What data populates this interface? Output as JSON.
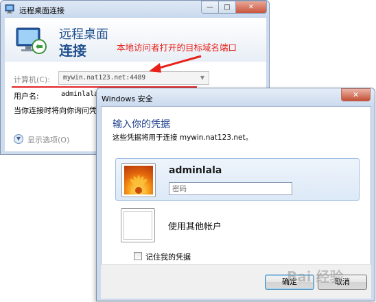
{
  "rdp_window": {
    "title": "远程桌面连接",
    "heading_line1": "远程桌面",
    "heading_line2": "连接",
    "computer_label": "计算机(C):",
    "computer_value": "mywin.nat123.net:4489",
    "username_label": "用户名:",
    "username_value": "adminlala",
    "hint_text": "当你连接时将向你询问凭",
    "show_options_label": "显示选项(O)"
  },
  "annotation": {
    "text": "本地访问者打开的目标域名端口",
    "color": "#e8211a"
  },
  "security_dialog": {
    "title": "Windows 安全",
    "heading": "输入你的凭据",
    "subtitle": "这些凭据将用于连接 mywin.nat123.net。",
    "selected_user": "adminlala",
    "password_placeholder": "密码",
    "other_account_label": "使用其他帐户",
    "remember_label": "记住我的凭据",
    "remember_checked": false,
    "ok_label": "确定",
    "cancel_label": "取消"
  },
  "watermark": {
    "text": "Bai 经验"
  },
  "colors": {
    "accent": "#1e4e8c",
    "annotation_red": "#e8211a",
    "titlebar": "#cddbec"
  }
}
